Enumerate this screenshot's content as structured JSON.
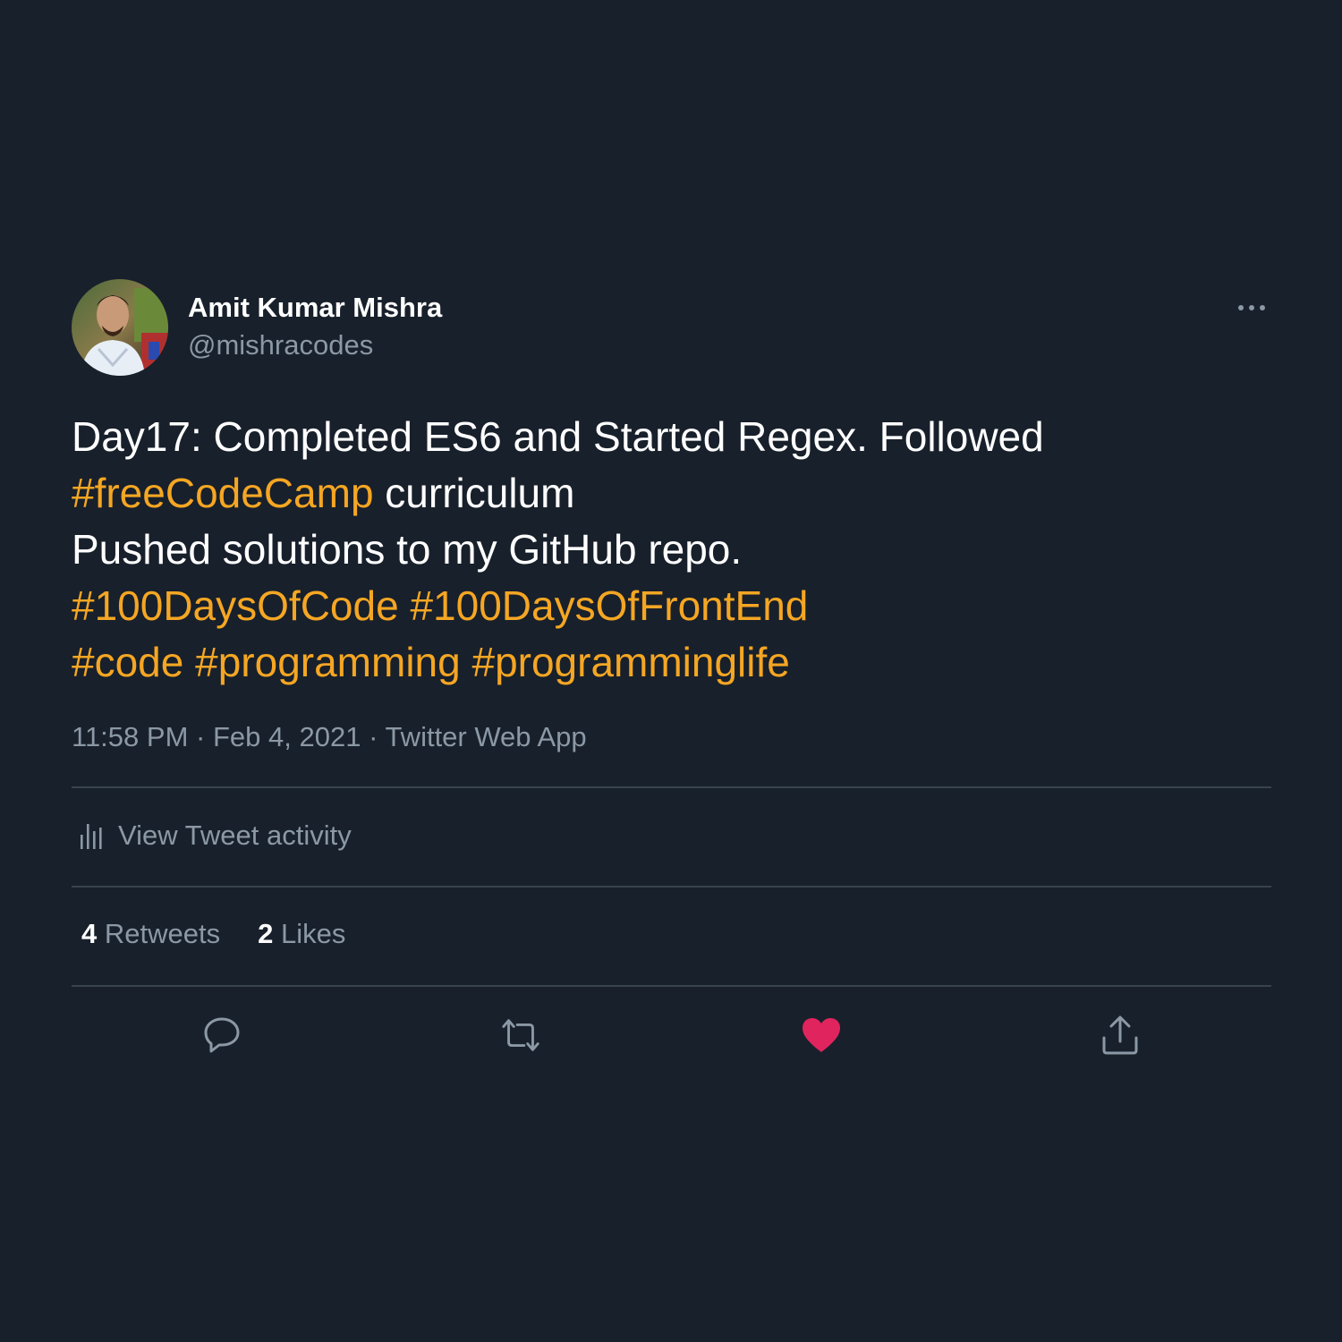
{
  "tweet": {
    "author": {
      "name": "Amit Kumar Mishra",
      "handle": "@mishracodes"
    },
    "text": {
      "line1": "Day17: Completed ES6 and Started Regex. Followed",
      "line2_tag": "#freeCodeCamp",
      "line2_rest": " curriculum",
      "line3": "Pushed solutions to my GitHub repo.",
      "line4_tag1": "#100DaysOfCode",
      "line4_tag2": "#100DaysOfFrontEnd",
      "line5_tag1": "#code",
      "line5_tag2": "#programming",
      "line5_tag3": "#programminglife"
    },
    "meta": {
      "time": "11:58 PM",
      "date": "Feb 4, 2021",
      "source": "Twitter Web App",
      "separator": "·"
    },
    "activity_label": "View Tweet activity",
    "stats": {
      "retweets_count": "4",
      "retweets_label": "Retweets",
      "likes_count": "2",
      "likes_label": "Likes"
    },
    "icons": {
      "more": "more-horizontal-icon",
      "activity": "bar-chart-icon",
      "reply": "reply-icon",
      "retweet": "retweet-icon",
      "like": "heart-icon",
      "share": "share-icon"
    },
    "colors": {
      "background": "#18202b",
      "hashtag": "#f5a623",
      "muted": "#8b98a5",
      "liked": "#e0245e",
      "divider": "#38444d"
    }
  }
}
